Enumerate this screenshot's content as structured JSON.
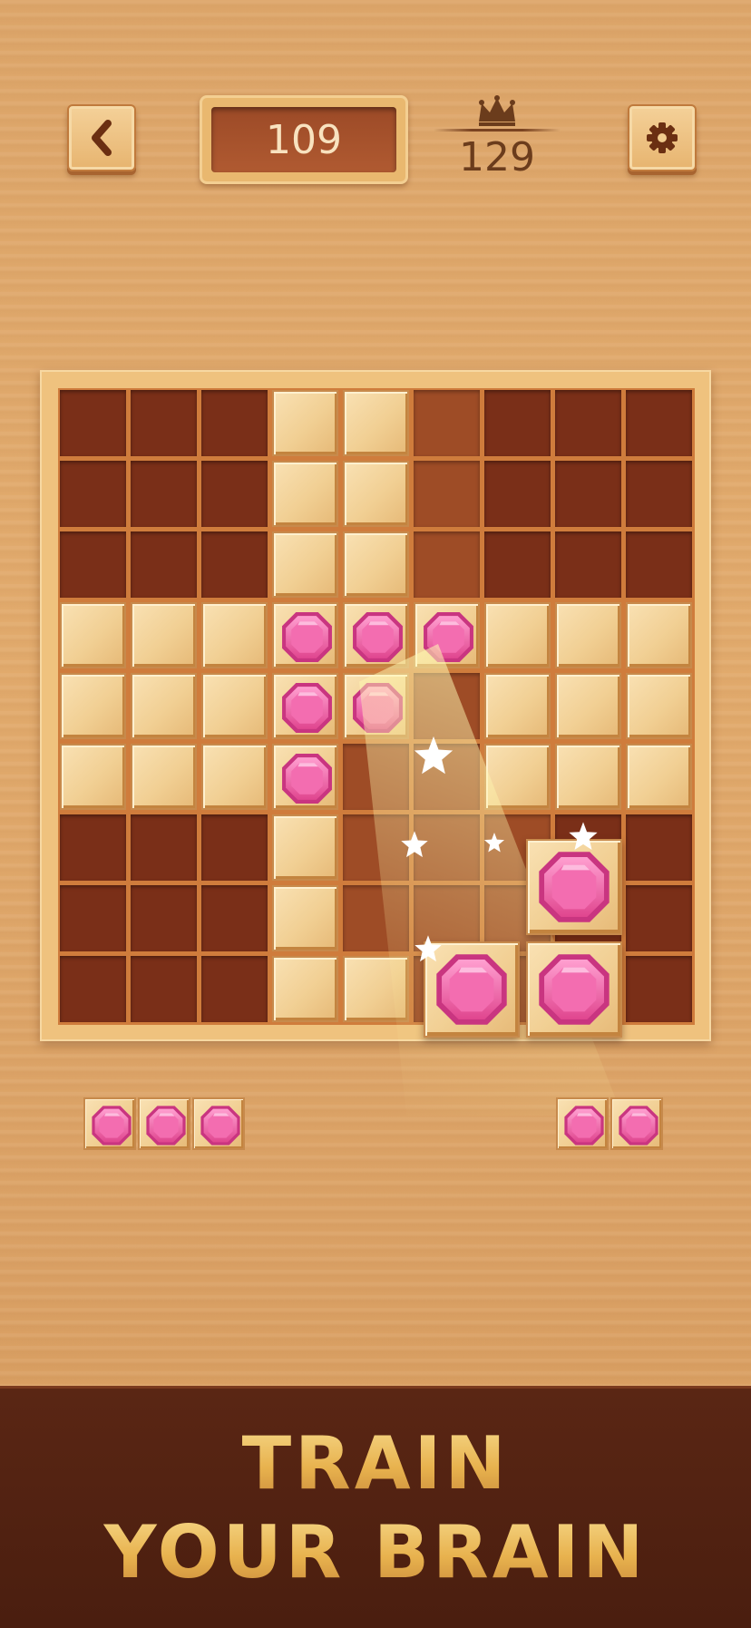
{
  "header": {
    "score": "109",
    "best_score": "129"
  },
  "icons": {
    "back": "chevron-left-icon",
    "settings": "gear-icon",
    "best": "crown-icon"
  },
  "board": {
    "size": 9,
    "rows": [
      "eee wwl eee",
      "eee wwl eee",
      "eee wwl eee",
      "wwwgggwww",
      "wwwgglwww",
      "wwwgllwww",
      "eeewwlee e",
      "eeewwleee",
      "eeewwleee"
    ],
    "filled": [
      [
        0,
        0,
        0,
        1,
        1,
        2,
        0,
        0,
        0
      ],
      [
        0,
        0,
        0,
        1,
        1,
        2,
        0,
        0,
        0
      ],
      [
        0,
        0,
        0,
        1,
        1,
        2,
        0,
        0,
        0
      ],
      [
        1,
        1,
        1,
        3,
        3,
        3,
        1,
        1,
        1
      ],
      [
        1,
        1,
        1,
        3,
        3,
        2,
        1,
        1,
        1
      ],
      [
        1,
        1,
        1,
        3,
        2,
        2,
        1,
        1,
        1
      ],
      [
        0,
        0,
        0,
        1,
        2,
        2,
        2,
        0,
        0
      ],
      [
        0,
        0,
        0,
        1,
        2,
        2,
        2,
        0,
        0
      ],
      [
        0,
        0,
        0,
        1,
        1,
        2,
        2,
        0,
        0
      ]
    ]
  },
  "tray": {
    "piece_left_count": 3,
    "piece_right_count": 2
  },
  "banner": {
    "line1": "TRAIN",
    "line2": "YOUR BRAIN"
  },
  "colors": {
    "gem_pink": "#f06fae",
    "wood_light": "#f3d39a",
    "cell_empty": "#7a2f18",
    "banner_gold": "#e9b757"
  }
}
